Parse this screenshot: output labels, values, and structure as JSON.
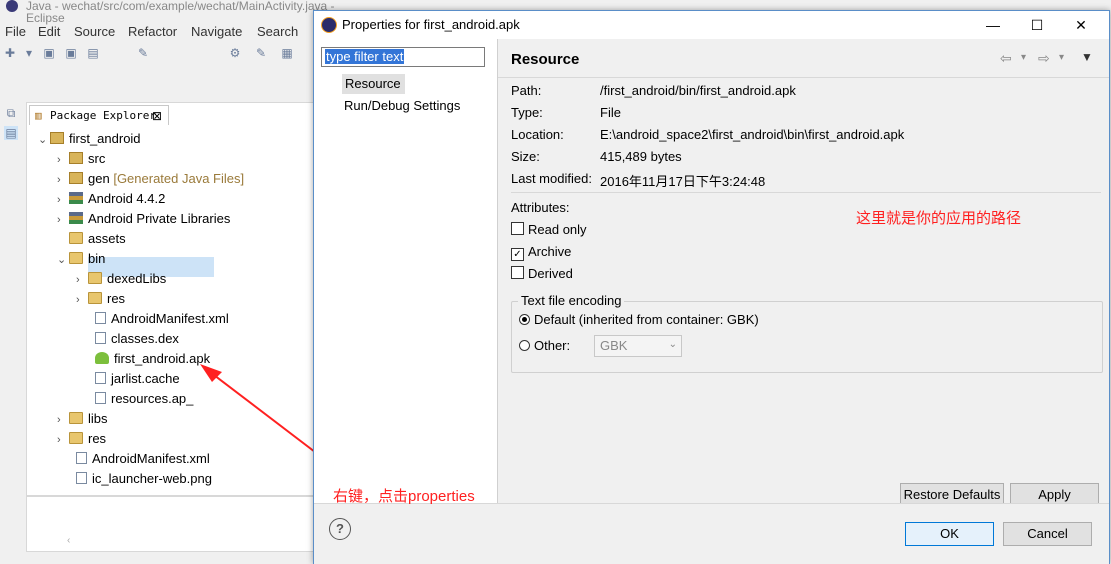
{
  "eclipse": {
    "window_title": "Java - wechat/src/com/example/wechat/MainActivity.java - Eclipse",
    "menu": [
      "File",
      "Edit",
      "Source",
      "Refactor",
      "Navigate",
      "Search"
    ],
    "package_explorer": {
      "tab_label": "Package Explorer",
      "tree": [
        {
          "label": "first_android",
          "hint": "",
          "icon": "project-icon",
          "expanded": true
        },
        {
          "label": "src",
          "hint": "",
          "icon": "package-folder-icon",
          "expanded": false
        },
        {
          "label": "gen",
          "hint": "[Generated Java Files]",
          "icon": "package-folder-icon",
          "expanded": false
        },
        {
          "label": "Android 4.4.2",
          "hint": "",
          "icon": "library-icon",
          "expanded": false
        },
        {
          "label": "Android Private Libraries",
          "hint": "",
          "icon": "library-icon",
          "expanded": false
        },
        {
          "label": "assets",
          "hint": "",
          "icon": "folder-icon",
          "expanded": null
        },
        {
          "label": "bin",
          "hint": "",
          "icon": "folder-icon",
          "expanded": true
        },
        {
          "label": "dexedLibs",
          "hint": "",
          "icon": "folder-icon",
          "expanded": false
        },
        {
          "label": "res",
          "hint": "",
          "icon": "folder-icon",
          "expanded": false
        },
        {
          "label": "AndroidManifest.xml",
          "hint": "",
          "icon": "xml-file-icon",
          "expanded": null
        },
        {
          "label": "classes.dex",
          "hint": "",
          "icon": "file-icon",
          "expanded": null
        },
        {
          "label": "first_android.apk",
          "hint": "",
          "icon": "apk-icon",
          "expanded": null
        },
        {
          "label": "jarlist.cache",
          "hint": "",
          "icon": "file-icon",
          "expanded": null
        },
        {
          "label": "resources.ap_",
          "hint": "",
          "icon": "file-icon",
          "expanded": null
        },
        {
          "label": "libs",
          "hint": "",
          "icon": "folder-icon",
          "expanded": false
        },
        {
          "label": "res",
          "hint": "",
          "icon": "folder-icon",
          "expanded": false
        },
        {
          "label": "AndroidManifest.xml",
          "hint": "",
          "icon": "xml-file-icon",
          "expanded": null
        },
        {
          "label": "ic_launcher-web.png",
          "hint": "",
          "icon": "image-file-icon",
          "expanded": null
        }
      ]
    }
  },
  "annotations": {
    "path_note": "这里就是你的应用的路径",
    "rightclick_note": "右键，点击properties",
    "color": "#ff2020"
  },
  "dialog": {
    "title": "Properties for first_android.apk",
    "filter_text": "type filter text",
    "nav": [
      "Resource",
      "Run/Debug Settings"
    ],
    "page_title": "Resource",
    "properties": {
      "path_label": "Path:",
      "path_value": "/first_android/bin/first_android.apk",
      "type_label": "Type:",
      "type_value": "File",
      "location_label": "Location:",
      "location_value": "E:\\android_space2\\first_android\\bin\\first_android.apk",
      "size_label": "Size:",
      "size_value": "415,489  bytes",
      "modified_label": "Last modified:",
      "modified_value": "2016年11月17日下午3:24:48"
    },
    "attributes": {
      "label": "Attributes:",
      "read_only": {
        "label": "Read only",
        "checked": false
      },
      "archive": {
        "label": "Archive",
        "checked": true
      },
      "derived": {
        "label": "Derived",
        "checked": false
      }
    },
    "encoding": {
      "legend": "Text file encoding",
      "default_option": "Default (inherited from container: GBK)",
      "default_selected": true,
      "other_option": "Other:",
      "other_value": "GBK"
    },
    "buttons": {
      "restore_defaults": "Restore Defaults",
      "apply": "Apply",
      "ok": "OK",
      "cancel": "Cancel",
      "help": "?"
    }
  }
}
